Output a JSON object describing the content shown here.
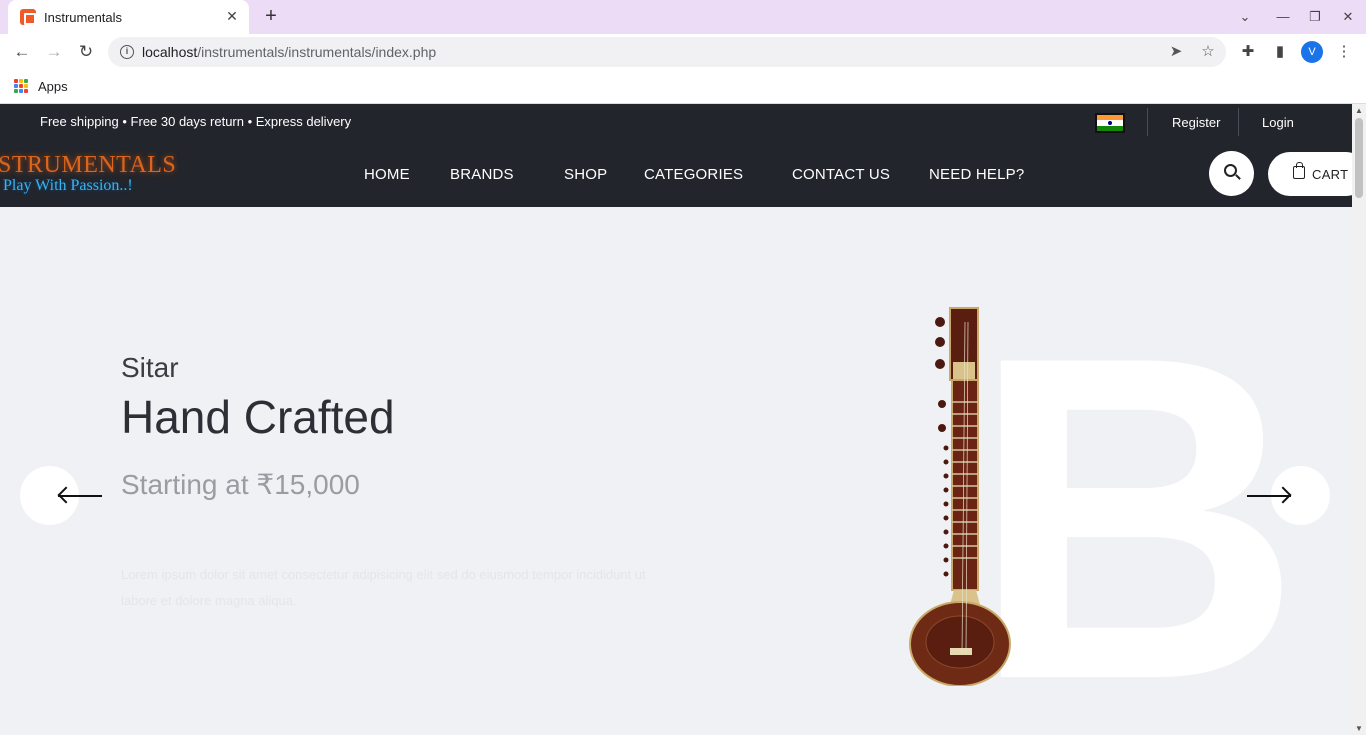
{
  "browser": {
    "tab_title": "Instrumentals",
    "tab_close": "✕",
    "new_tab": "+",
    "url_host": "localhost",
    "url_path": "/instrumentals/instrumentals/index.php",
    "bookmarks_apps": "Apps",
    "avatar_letter": "V"
  },
  "topbar": {
    "shipping_text": "Free shipping • Free 30 days return • Express delivery",
    "register": "Register",
    "login": "Login"
  },
  "logo": {
    "name": "STRUMENTALS",
    "tagline": "Play With Passion..!"
  },
  "nav": {
    "items": [
      "HOME",
      "BRANDS",
      "SHOP",
      "CATEGORIES",
      "CONTACT US",
      "NEED HELP?"
    ]
  },
  "cart_label": "CART",
  "hero": {
    "subtitle": "Sitar",
    "title": "Hand Crafted",
    "price": "Starting at ₹15,000",
    "description": "Lorem ipsum dolor sit amet consectetur adipisicing elit sed do eiusmod tempor incididunt ut labore et dolore magna aliqua.",
    "big_letter": "B"
  },
  "icons": {
    "prev": "arrow-left-icon",
    "next": "arrow-right-icon",
    "search": "search-icon",
    "cart": "shopping-bag-icon"
  },
  "colors": {
    "header_bg": "#22252b",
    "hero_bg": "#f0f1f4",
    "logo_orange": "#d9661c",
    "tagline_blue": "#3ab3f0",
    "tabbar_bg": "#ecdcf5"
  }
}
